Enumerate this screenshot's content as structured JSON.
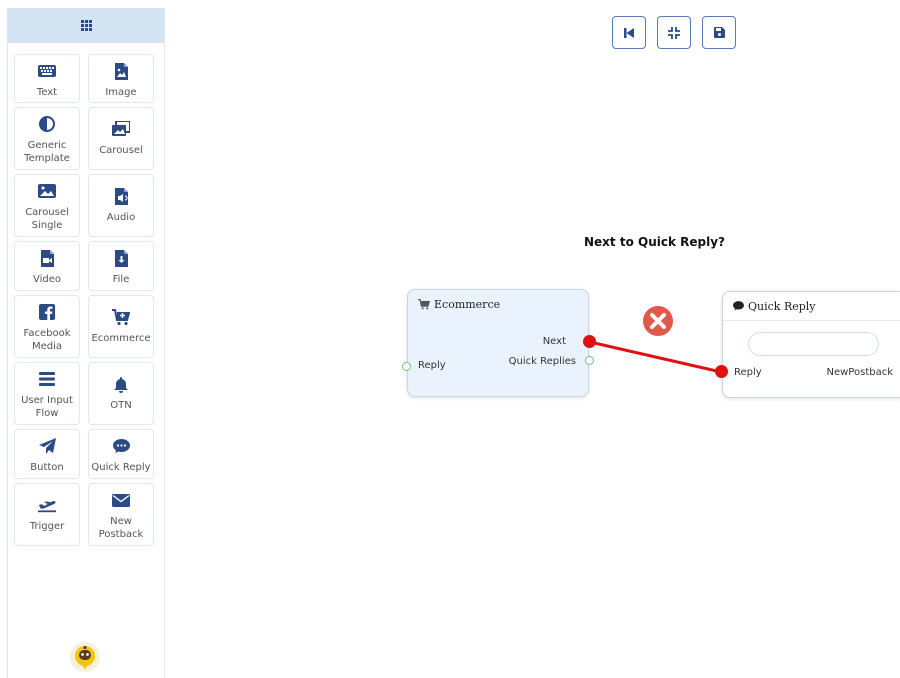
{
  "sidebar": {
    "tiles": [
      {
        "label": "Text",
        "icon": "keyboard-icon"
      },
      {
        "label": "Image",
        "icon": "image-file-icon"
      },
      {
        "label": "Generic Template",
        "icon": "contrast-icon"
      },
      {
        "label": "Carousel",
        "icon": "images-icon"
      },
      {
        "label": "Carousel Single",
        "icon": "picture-icon"
      },
      {
        "label": "Audio",
        "icon": "audio-file-icon"
      },
      {
        "label": "Video",
        "icon": "video-file-icon"
      },
      {
        "label": "File",
        "icon": "download-file-icon"
      },
      {
        "label": "Facebook Media",
        "icon": "facebook-icon"
      },
      {
        "label": "Ecommerce",
        "icon": "cart-icon"
      },
      {
        "label": "User Input Flow",
        "icon": "bars-icon"
      },
      {
        "label": "OTN",
        "icon": "bell-icon"
      },
      {
        "label": "Button",
        "icon": "paper-plane-icon"
      },
      {
        "label": "Quick Reply",
        "icon": "chat-icon"
      },
      {
        "label": "Trigger",
        "icon": "plane-departure-icon"
      },
      {
        "label": "New Postback",
        "icon": "envelope-icon"
      }
    ]
  },
  "toolbar": {
    "buttons": [
      "step-backward-icon",
      "compress-icon",
      "save-icon"
    ]
  },
  "canvas": {
    "hint": "Next to Quick Reply?",
    "ecommerce_node": {
      "title": "Ecommerce",
      "input_label": "Reply",
      "outputs": [
        "Next",
        "Quick Replies"
      ]
    },
    "quick_reply_node": {
      "title": "Quick Reply",
      "input_label": "Reply",
      "output_label": "NewPostback"
    }
  },
  "colors": {
    "accent": "#2c4a86",
    "connection": "#e01111",
    "delete": "#e0594a",
    "node_bg_selected": "#eaf3fd"
  }
}
